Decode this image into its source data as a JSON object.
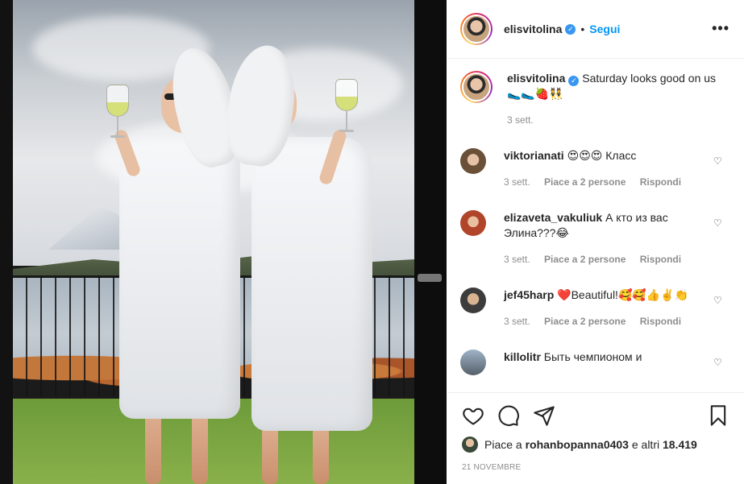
{
  "post": {
    "author": "elisvitolina",
    "follow_label": "Segui",
    "separator": "•",
    "more_label": "•••"
  },
  "caption": {
    "user": "elisvitolina",
    "text": "Saturday looks good on us 🥿🥿🍓👯",
    "time": "3 sett."
  },
  "comments": [
    {
      "user": "viktorianati",
      "text": "😍😍😍 Класс",
      "time": "3 sett.",
      "likes": "Piace a 2 persone",
      "reply": "Rispondi"
    },
    {
      "user": "elizaveta_vakuliuk",
      "text": "А кто из вас Элина???😂",
      "time": "3 sett.",
      "likes": "Piace a 2 persone",
      "reply": "Rispondi"
    },
    {
      "user": "jef45harp",
      "text": "❤️Beautiful!🥰🥰👍✌️👏",
      "time": "3 sett.",
      "likes": "Piace a 2 persone",
      "reply": "Rispondi"
    },
    {
      "user": "killolitr",
      "text": "Быть чемпионом и"
    }
  ],
  "likes": {
    "prefix": "Piace a",
    "user": "rohanbopanna0403",
    "suffix": "e altri",
    "count": "18.419"
  },
  "date": "21 NOVEMBRE",
  "icons": {
    "like": "heart-icon",
    "comment": "comment-bubble-icon",
    "share": "paper-plane-icon",
    "save": "bookmark-icon",
    "verified": "verified-badge-icon"
  },
  "colors": {
    "link": "#0095f6",
    "verified": "#3897f0",
    "muted": "#8e8e8e"
  }
}
